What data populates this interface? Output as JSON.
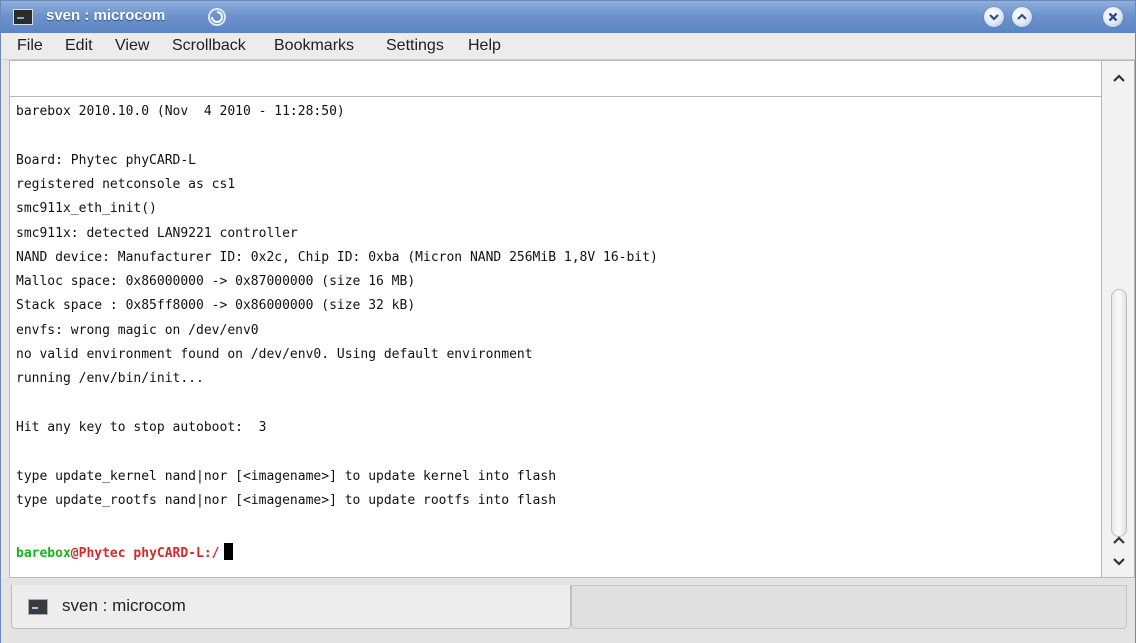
{
  "window": {
    "title": "sven : microcom"
  },
  "menu": [
    "File",
    "Edit",
    "View",
    "Scrollback",
    "Bookmarks",
    "Settings",
    "Help"
  ],
  "terminal": {
    "lines": [
      "barebox 2010.10.0 (Nov  4 2010 - 11:28:50)",
      "",
      "Board: Phytec phyCARD-L",
      "registered netconsole as cs1",
      "smc911x_eth_init()",
      "smc911x: detected LAN9221 controller",
      "NAND device: Manufacturer ID: 0x2c, Chip ID: 0xba (Micron NAND 256MiB 1,8V 16-bit)",
      "Malloc space: 0x86000000 -> 0x87000000 (size 16 MB)",
      "Stack space : 0x85ff8000 -> 0x86000000 (size 32 kB)",
      "envfs: wrong magic on /dev/env0",
      "no valid environment found on /dev/env0. Using default environment",
      "running /env/bin/init...",
      "",
      "Hit any key to stop autoboot:  3",
      "",
      "type update_kernel nand|nor [<imagename>] to update kernel into flash",
      "type update_rootfs nand|nor [<imagename>] to update rootfs into flash",
      ""
    ],
    "prompt_user": "barebox",
    "prompt_host": "@Phytec phyCARD-L:/"
  },
  "tabs": [
    {
      "label": "sven : microcom"
    }
  ]
}
